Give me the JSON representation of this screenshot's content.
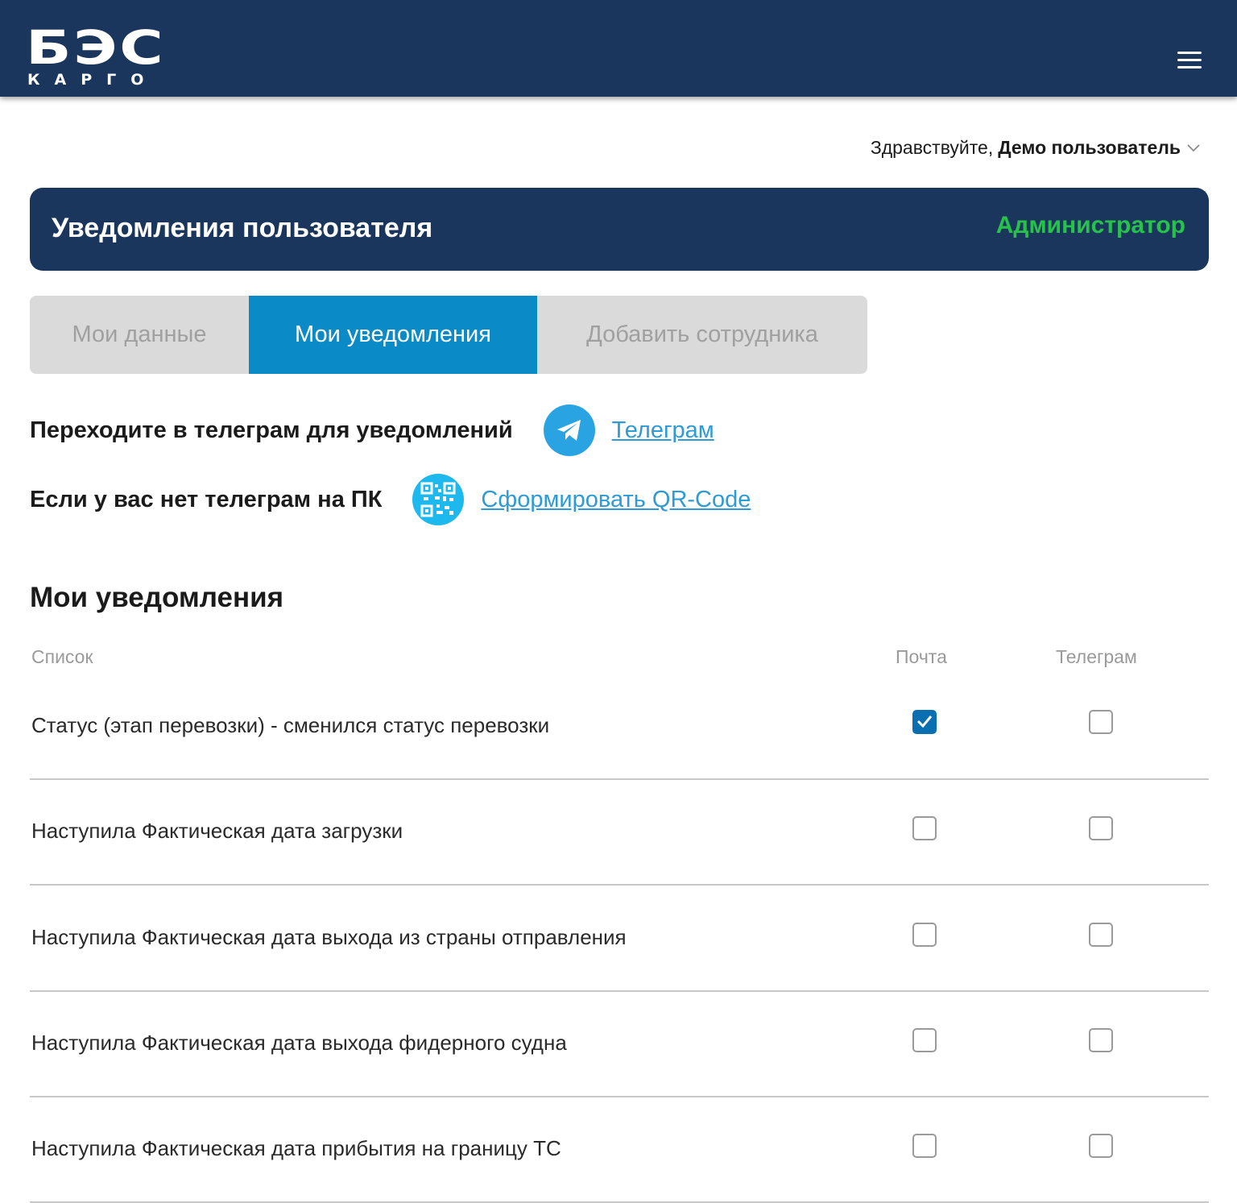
{
  "header": {
    "logo_main": "БЭС",
    "logo_sub": "КАРГО",
    "menu_icon": "hamburger-menu-icon"
  },
  "user": {
    "greeting": "Здравствуйте,",
    "name": "Демо пользователь",
    "dropdown_icon": "chevron-down-icon"
  },
  "banner": {
    "title": "Уведомления пользователя",
    "role": "Администратор",
    "role_color": "#27c24c"
  },
  "tabs": [
    {
      "label": "Мои данные",
      "active": false
    },
    {
      "label": "Мои уведомления",
      "active": true
    },
    {
      "label": "Добавить сотрудника",
      "active": false
    }
  ],
  "telegram_info": {
    "text": "Переходите в телеграм для уведомлений",
    "icon": "telegram-icon",
    "link": "Телеграм"
  },
  "qr_info": {
    "text": "Если у вас нет телеграм на ПК",
    "icon": "qr-code-icon",
    "link": "Сформировать QR-Code"
  },
  "notifications": {
    "title": "Мои уведомления",
    "headers": {
      "list": "Список",
      "mail": "Почта",
      "telegram": "Телеграм"
    },
    "rows": [
      {
        "label": "Статус (этап перевозки) - сменился статус перевозки",
        "mail": true,
        "telegram": false
      },
      {
        "label": "Наступила Фактическая дата загрузки",
        "mail": false,
        "telegram": false
      },
      {
        "label": "Наступила Фактическая дата выхода из страны отправления",
        "mail": false,
        "telegram": false
      },
      {
        "label": "Наступила Фактическая дата выхода фидерного судна",
        "mail": false,
        "telegram": false
      },
      {
        "label": "Наступила Фактическая дата прибытия на границу ТС",
        "mail": false,
        "telegram": false
      }
    ]
  },
  "colors": {
    "header_bg": "#1b365c",
    "tab_active": "#0a8ac6",
    "link": "#2e9bd6",
    "checkbox_checked": "#0a6fb0"
  }
}
